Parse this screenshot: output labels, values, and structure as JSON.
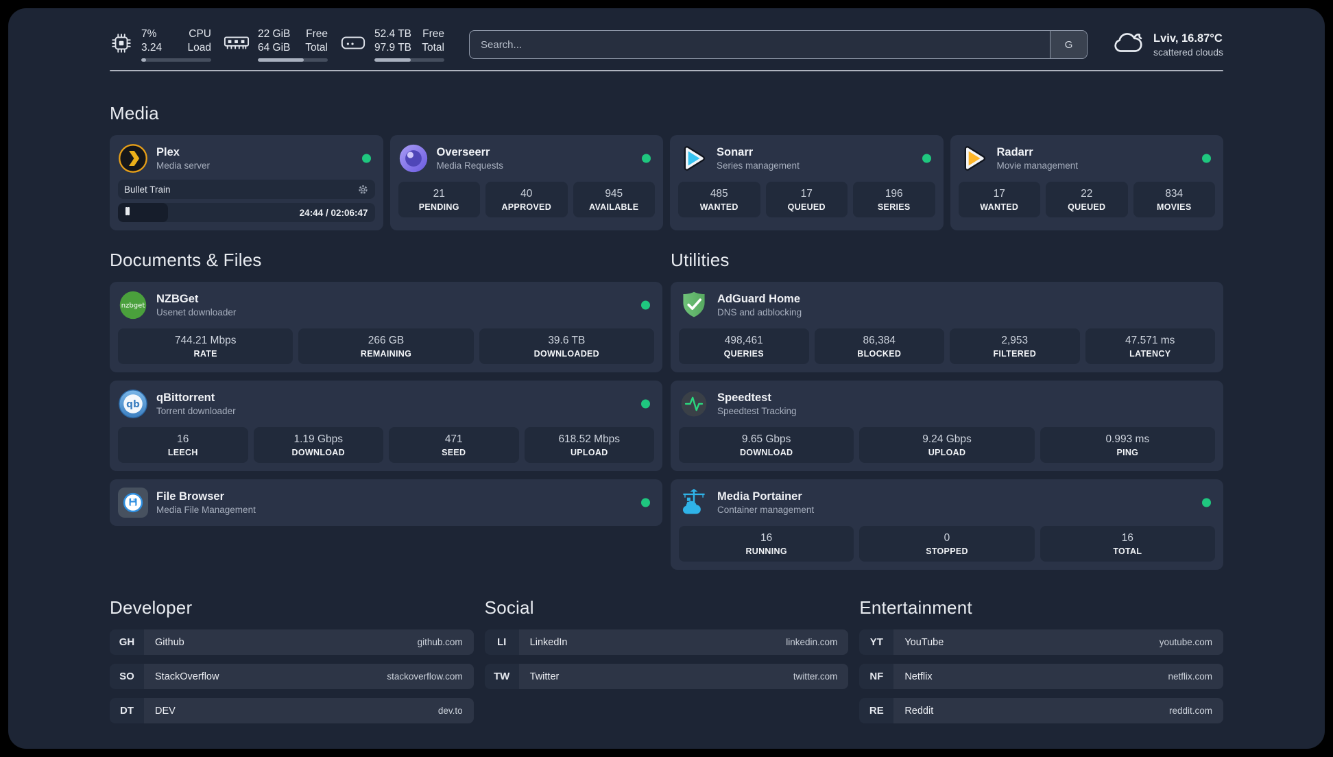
{
  "colors": {
    "status_online": "#1fc77f",
    "plex_gold": "#e8a018",
    "sonarr_cyan": "#36c3f1",
    "radarr_yellow": "#ffb629",
    "nzbget_green": "#4aa03c",
    "qbittorrent_blue": "#3c7fc0",
    "adguard_green": "#64b56e",
    "speedtest_green": "#2bd67e",
    "portainer_blue": "#2fb3e8",
    "overseerr_purple": "#6a5ae0"
  },
  "header": {
    "stats": [
      {
        "icon": "cpu",
        "value1": "7%",
        "value2": "3.24",
        "label1": "CPU",
        "label2": "Load",
        "progress": 7
      },
      {
        "icon": "ram",
        "value1": "22 GiB",
        "value2": "64 GiB",
        "label1": "Free",
        "label2": "Total",
        "progress": 66
      },
      {
        "icon": "disk",
        "value1": "52.4 TB",
        "value2": "97.9 TB",
        "label1": "Free",
        "label2": "Total",
        "progress": 52
      }
    ],
    "search": {
      "placeholder": "Search...",
      "button_label": "G"
    },
    "weather": {
      "location_temp": "Lviv, 16.87°C",
      "condition": "scattered clouds"
    }
  },
  "media": {
    "title": "Media",
    "plex": {
      "title": "Plex",
      "subtitle": "Media server",
      "now_playing": "Bullet Train",
      "time": "24:44 / 02:06:47",
      "progress_percent": 20
    },
    "overseerr": {
      "title": "Overseerr",
      "subtitle": "Media Requests",
      "stats": [
        {
          "value": "21",
          "label": "PENDING"
        },
        {
          "value": "40",
          "label": "APPROVED"
        },
        {
          "value": "945",
          "label": "AVAILABLE"
        }
      ]
    },
    "sonarr": {
      "title": "Sonarr",
      "subtitle": "Series management",
      "stats": [
        {
          "value": "485",
          "label": "WANTED"
        },
        {
          "value": "17",
          "label": "QUEUED"
        },
        {
          "value": "196",
          "label": "SERIES"
        }
      ]
    },
    "radarr": {
      "title": "Radarr",
      "subtitle": "Movie management",
      "stats": [
        {
          "value": "17",
          "label": "WANTED"
        },
        {
          "value": "22",
          "label": "QUEUED"
        },
        {
          "value": "834",
          "label": "MOVIES"
        }
      ]
    }
  },
  "documents": {
    "title": "Documents & Files",
    "nzbget": {
      "title": "NZBGet",
      "subtitle": "Usenet downloader",
      "stats": [
        {
          "value": "744.21 Mbps",
          "label": "RATE"
        },
        {
          "value": "266 GB",
          "label": "REMAINING"
        },
        {
          "value": "39.6 TB",
          "label": "DOWNLOADED"
        }
      ]
    },
    "qbittorrent": {
      "title": "qBittorrent",
      "subtitle": "Torrent downloader",
      "stats": [
        {
          "value": "16",
          "label": "LEECH"
        },
        {
          "value": "1.19 Gbps",
          "label": "DOWNLOAD"
        },
        {
          "value": "471",
          "label": "SEED"
        },
        {
          "value": "618.52 Mbps",
          "label": "UPLOAD"
        }
      ]
    },
    "filebrowser": {
      "title": "File Browser",
      "subtitle": "Media File Management"
    }
  },
  "utilities": {
    "title": "Utilities",
    "adguard": {
      "title": "AdGuard Home",
      "subtitle": "DNS and adblocking",
      "stats": [
        {
          "value": "498,461",
          "label": "QUERIES"
        },
        {
          "value": "86,384",
          "label": "BLOCKED"
        },
        {
          "value": "2,953",
          "label": "FILTERED"
        },
        {
          "value": "47.571 ms",
          "label": "LATENCY"
        }
      ]
    },
    "speedtest": {
      "title": "Speedtest",
      "subtitle": "Speedtest Tracking",
      "stats": [
        {
          "value": "9.65 Gbps",
          "label": "DOWNLOAD"
        },
        {
          "value": "9.24 Gbps",
          "label": "UPLOAD"
        },
        {
          "value": "0.993 ms",
          "label": "PING"
        }
      ]
    },
    "portainer": {
      "title": "Media Portainer",
      "subtitle": "Container management",
      "stats": [
        {
          "value": "16",
          "label": "RUNNING"
        },
        {
          "value": "0",
          "label": "STOPPED"
        },
        {
          "value": "16",
          "label": "TOTAL"
        }
      ]
    }
  },
  "links": {
    "developer": {
      "title": "Developer",
      "items": [
        {
          "abbr": "GH",
          "name": "Github",
          "url": "github.com"
        },
        {
          "abbr": "SO",
          "name": "StackOverflow",
          "url": "stackoverflow.com"
        },
        {
          "abbr": "DT",
          "name": "DEV",
          "url": "dev.to"
        }
      ]
    },
    "social": {
      "title": "Social",
      "items": [
        {
          "abbr": "LI",
          "name": "LinkedIn",
          "url": "linkedin.com"
        },
        {
          "abbr": "TW",
          "name": "Twitter",
          "url": "twitter.com"
        }
      ]
    },
    "entertainment": {
      "title": "Entertainment",
      "items": [
        {
          "abbr": "YT",
          "name": "YouTube",
          "url": "youtube.com"
        },
        {
          "abbr": "NF",
          "name": "Netflix",
          "url": "netflix.com"
        },
        {
          "abbr": "RE",
          "name": "Reddit",
          "url": "reddit.com"
        }
      ]
    }
  }
}
